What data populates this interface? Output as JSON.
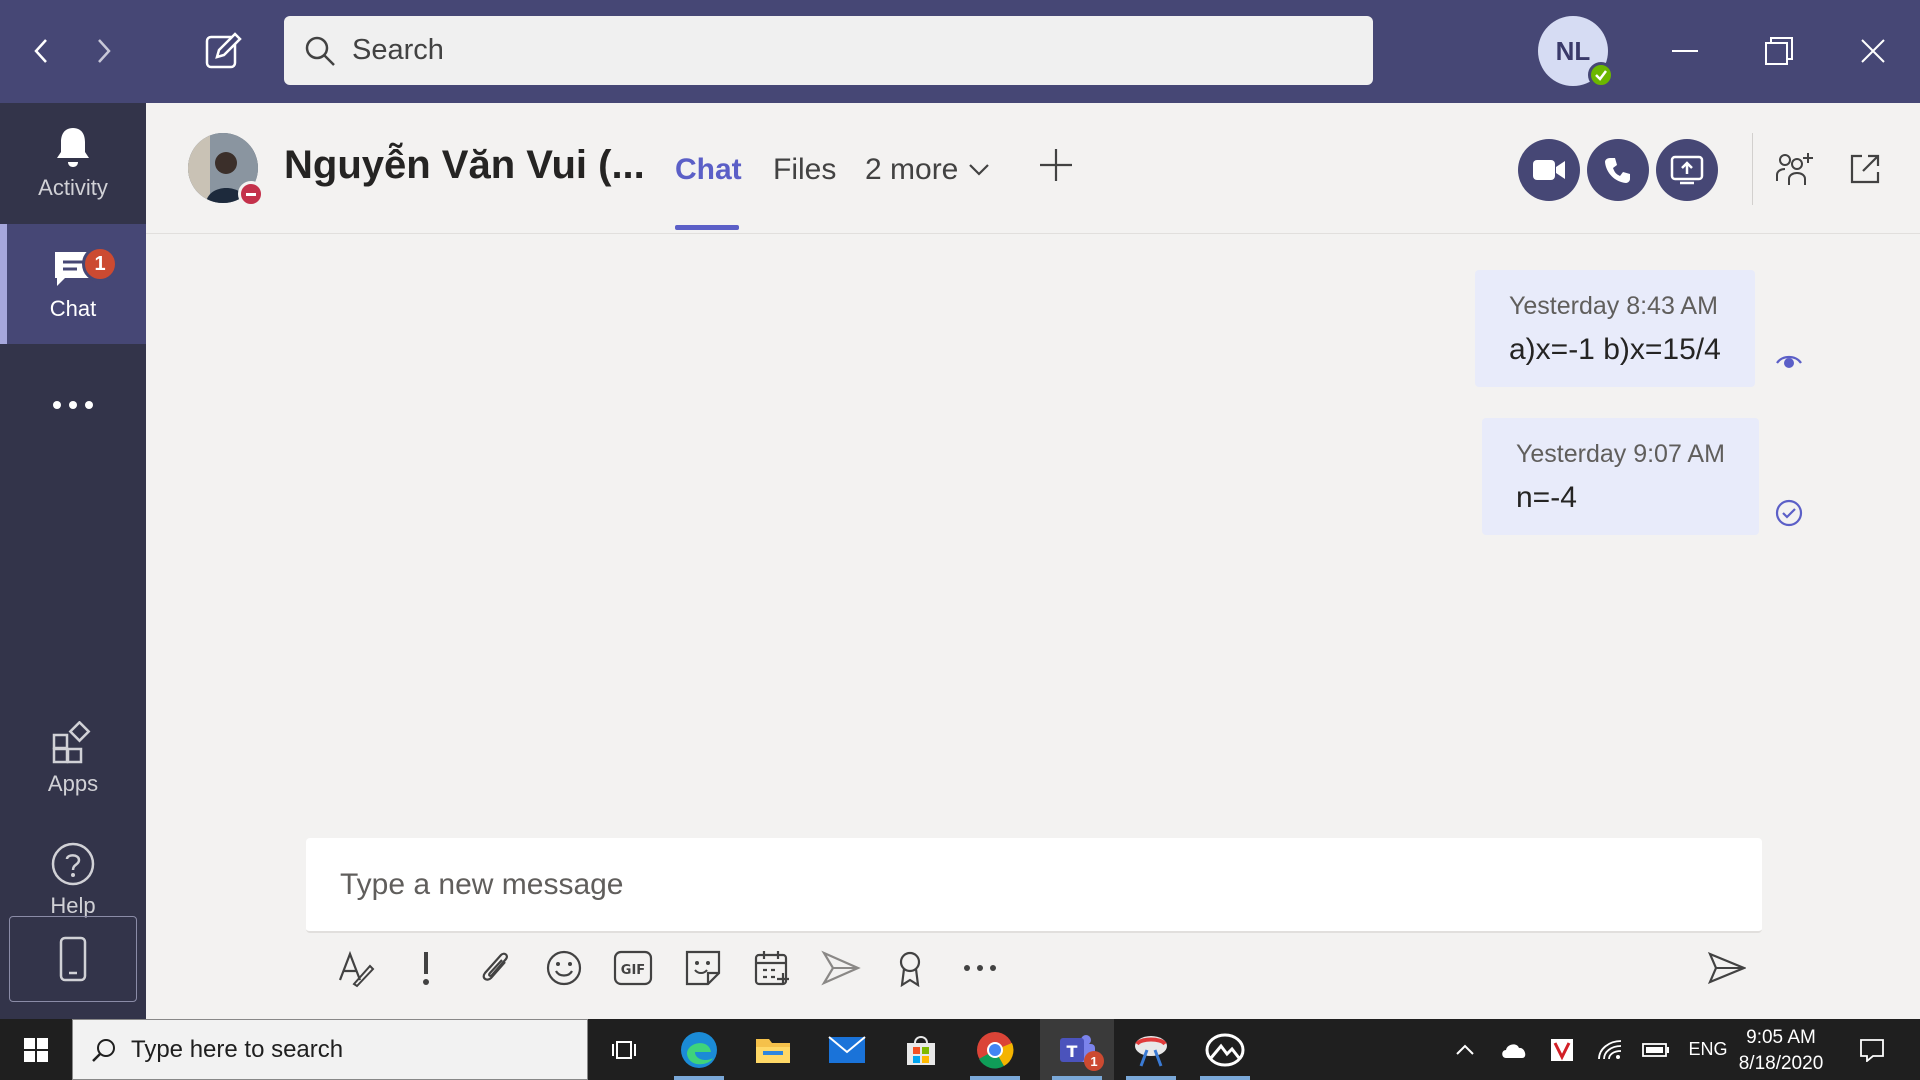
{
  "titlebar": {
    "search_placeholder": "Search",
    "user_initials": "NL",
    "icons": [
      "chevron-left-icon",
      "chevron-right-icon",
      "compose-icon",
      "search-icon",
      "minimize-icon",
      "restore-icon",
      "close-icon"
    ]
  },
  "rail": {
    "items": [
      {
        "label": "Activity",
        "icon": "bell-icon"
      },
      {
        "label": "Chat",
        "icon": "chat-icon",
        "badge": "1"
      },
      {
        "label": "",
        "icon": "more-icon"
      },
      {
        "label": "Apps",
        "icon": "apps-icon"
      },
      {
        "label": "Help",
        "icon": "help-icon"
      }
    ]
  },
  "header": {
    "contact_name": "Nguyễn Văn Vui (...",
    "tabs": [
      {
        "label": "Chat"
      },
      {
        "label": "Files"
      },
      {
        "label": "2 more"
      }
    ],
    "accent_color": "#5b5fc7"
  },
  "messages": [
    {
      "timestamp": "Yesterday 8:43 AM",
      "text": "a)x=-1 b)x=15/4",
      "status": "seen"
    },
    {
      "timestamp": "Yesterday 9:07 AM",
      "text": "n=-4",
      "status": "sent"
    }
  ],
  "compose": {
    "placeholder": "Type a new message",
    "tools": [
      "format-icon",
      "important-icon",
      "attach-icon",
      "emoji-icon",
      "gif-icon",
      "sticker-icon",
      "schedule-meeting-icon",
      "stream-icon",
      "praise-icon",
      "more-options-icon",
      "send-icon"
    ]
  },
  "taskbar": {
    "search_placeholder": "Type here to search",
    "language": "ENG",
    "time": "9:05 AM",
    "date": "8/18/2020",
    "teams_badge": "1"
  }
}
